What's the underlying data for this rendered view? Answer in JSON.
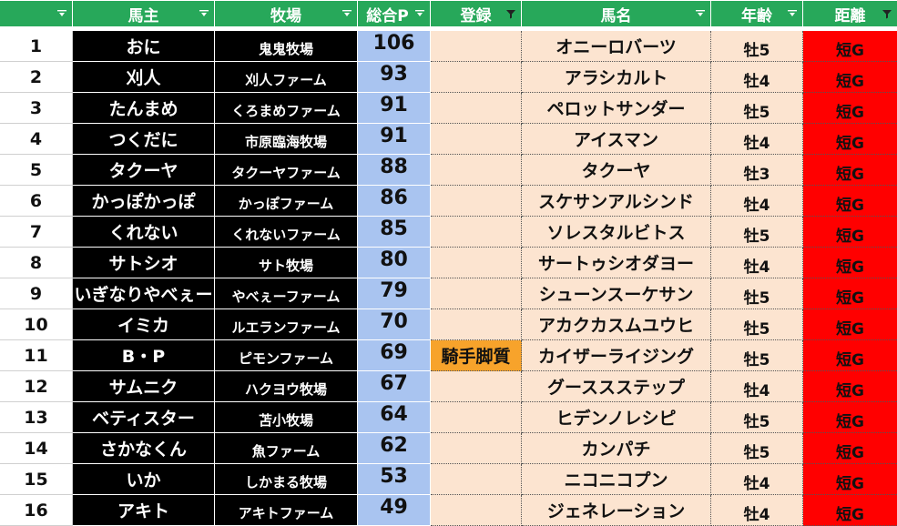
{
  "header": {
    "columns": [
      {
        "key": "no",
        "label": "",
        "filter": "dropdown"
      },
      {
        "key": "owner",
        "label": "馬主",
        "filter": "dropdown"
      },
      {
        "key": "farm",
        "label": "牧場",
        "filter": "dropdown"
      },
      {
        "key": "points",
        "label": "総合P",
        "filter": "dropdown"
      },
      {
        "key": "registration",
        "label": "登録",
        "filter": "funnel"
      },
      {
        "key": "horse",
        "label": "馬名",
        "filter": "dropdown"
      },
      {
        "key": "age",
        "label": "年齢",
        "filter": "dropdown"
      },
      {
        "key": "distance",
        "label": "距離",
        "filter": "funnel"
      }
    ]
  },
  "rows": [
    {
      "no": "1",
      "owner": "おに",
      "farm": "鬼鬼牧場",
      "points": "106",
      "registration": "",
      "horse": "オニーロバーツ",
      "age": "牡5",
      "distance": "短G"
    },
    {
      "no": "2",
      "owner": "刈人",
      "farm": "刈人ファーム",
      "points": "93",
      "registration": "",
      "horse": "アラシカルト",
      "age": "牡4",
      "distance": "短G"
    },
    {
      "no": "3",
      "owner": "たんまめ",
      "farm": "くろまめファーム",
      "points": "91",
      "registration": "",
      "horse": "ペロットサンダー",
      "age": "牡5",
      "distance": "短G"
    },
    {
      "no": "4",
      "owner": "つくだに",
      "farm": "市原臨海牧場",
      "points": "91",
      "registration": "",
      "horse": "アイスマン",
      "age": "牡4",
      "distance": "短G"
    },
    {
      "no": "5",
      "owner": "タクーヤ",
      "farm": "タクーヤファーム",
      "points": "88",
      "registration": "",
      "horse": "タクーヤ",
      "age": "牡3",
      "distance": "短G"
    },
    {
      "no": "6",
      "owner": "かっぽかっぽ",
      "farm": "かっぽファーム",
      "points": "86",
      "registration": "",
      "horse": "スケサンアルシンド",
      "age": "牡4",
      "distance": "短G"
    },
    {
      "no": "7",
      "owner": "くれない",
      "farm": "くれないファーム",
      "points": "85",
      "registration": "",
      "horse": "ソレスタルビトス",
      "age": "牡5",
      "distance": "短G"
    },
    {
      "no": "8",
      "owner": "サトシオ",
      "farm": "サト牧場",
      "points": "80",
      "registration": "",
      "horse": "サートゥシオダヨー",
      "age": "牡4",
      "distance": "短G"
    },
    {
      "no": "9",
      "owner": "いぎなりやべぇー",
      "farm": "やべぇーファーム",
      "points": "79",
      "registration": "",
      "horse": "シューンスーケサン",
      "age": "牡5",
      "distance": "短G"
    },
    {
      "no": "10",
      "owner": "イミカ",
      "farm": "ルエランファーム",
      "points": "70",
      "registration": "",
      "horse": "アカクカスムユウヒ",
      "age": "牡5",
      "distance": "短G"
    },
    {
      "no": "11",
      "owner": "B・P",
      "farm": "ピモンファーム",
      "points": "69",
      "registration": "騎手脚質",
      "horse": "カイザーライジング",
      "age": "牡5",
      "distance": "短G"
    },
    {
      "no": "12",
      "owner": "サムニク",
      "farm": "ハクヨウ牧場",
      "points": "67",
      "registration": "",
      "horse": "グーススステップ",
      "age": "牡4",
      "distance": "短G"
    },
    {
      "no": "13",
      "owner": "ベティスター",
      "farm": "苫小牧場",
      "points": "64",
      "registration": "",
      "horse": "ヒデンノレシピ",
      "age": "牡5",
      "distance": "短G"
    },
    {
      "no": "14",
      "owner": "さかなくん",
      "farm": "魚ファーム",
      "points": "62",
      "registration": "",
      "horse": "カンパチ",
      "age": "牡5",
      "distance": "短G"
    },
    {
      "no": "15",
      "owner": "いか",
      "farm": "しかまる牧場",
      "points": "53",
      "registration": "",
      "horse": "ニコニコプン",
      "age": "牡4",
      "distance": "短G"
    },
    {
      "no": "16",
      "owner": "アキト",
      "farm": "アキトファーム",
      "points": "49",
      "registration": "",
      "horse": "ジェネレーション",
      "age": "牡4",
      "distance": "短G"
    }
  ],
  "colors": {
    "header_bg": "#27a85a",
    "owner_bg": "#000000",
    "points_bg": "#a9c4f0",
    "entry_bg": "#fce4d0",
    "registration_filled_bg": "#f7a32b",
    "distance_bg": "#ff0000"
  }
}
